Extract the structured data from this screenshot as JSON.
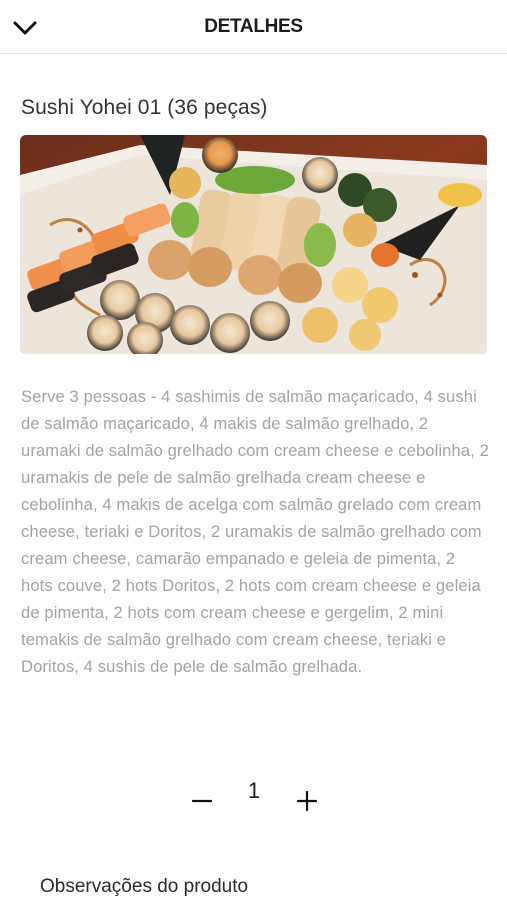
{
  "header": {
    "title": "DETALHES",
    "back_icon": "chevron-down-icon"
  },
  "product": {
    "title": "Sushi Yohei 01 (36 peças)",
    "description": "Serve 3 pessoas - 4 sashimis de salmão maçaricado, 4 sushi de salmão maçaricado, 4 makis de salmão grelhado, 2 uramaki de salmão grelhado com cream cheese e cebolinha, 2 uramakis de pele de salmão grelhada cream cheese e cebolinha, 4 makis de acelga com salmão grelado com cream cheese, teriaki e Doritos, 2 uramakis de salmão grelhado com cream cheese, camarão empanado e geleia de pimenta, 2 hots couve, 2 hots Doritos, 2 hots com cream cheese e geleia de pimenta, 2 hots com cream cheese e gergelim, 2 mini temakis de salmão grelhado com cream cheese, teriaki e Doritos, 4 sushis de pele de salmão grelhada."
  },
  "quantity": {
    "value": "1",
    "minus_icon": "minus-icon",
    "plus_icon": "plus-icon"
  },
  "notes": {
    "label": "Observações do produto"
  },
  "colors": {
    "description_text": "#a3a3a3",
    "header_border": "#e2e2e2"
  }
}
